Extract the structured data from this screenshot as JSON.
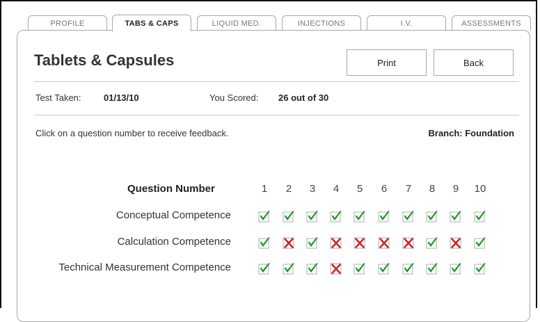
{
  "tabs": [
    {
      "label": "PROFILE",
      "active": false
    },
    {
      "label": "TABS & CAPS",
      "active": true
    },
    {
      "label": "LIQUID MED.",
      "active": false
    },
    {
      "label": "INJECTIONS",
      "active": false
    },
    {
      "label": "I.V.",
      "active": false
    },
    {
      "label": "ASSESSMENTS",
      "active": false
    }
  ],
  "page_title": "Tablets & Capsules",
  "buttons": {
    "print": "Print",
    "back": "Back"
  },
  "test": {
    "taken_label": "Test Taken:",
    "taken_value": "01/13/10",
    "score_label": "You Scored:",
    "score_value": "26 out of 30"
  },
  "instruction": "Click on a question number to receive feedback.",
  "branch": "Branch: Foundation",
  "grid": {
    "header_label": "Question Number",
    "question_numbers": [
      "1",
      "2",
      "3",
      "4",
      "5",
      "6",
      "7",
      "8",
      "9",
      "10"
    ],
    "rows": [
      {
        "label": "Conceptual Competence",
        "results": [
          true,
          true,
          true,
          true,
          true,
          true,
          true,
          true,
          true,
          true
        ]
      },
      {
        "label": "Calculation Competence",
        "results": [
          true,
          false,
          true,
          false,
          false,
          false,
          false,
          true,
          false,
          true
        ]
      },
      {
        "label": "Technical Measurement Competence",
        "results": [
          true,
          true,
          true,
          false,
          true,
          true,
          true,
          true,
          true,
          true
        ]
      }
    ]
  },
  "colors": {
    "correct": "#1e9a2e",
    "incorrect": "#d0232b"
  },
  "icons": {
    "correct": "check-icon",
    "incorrect": "cross-icon"
  }
}
